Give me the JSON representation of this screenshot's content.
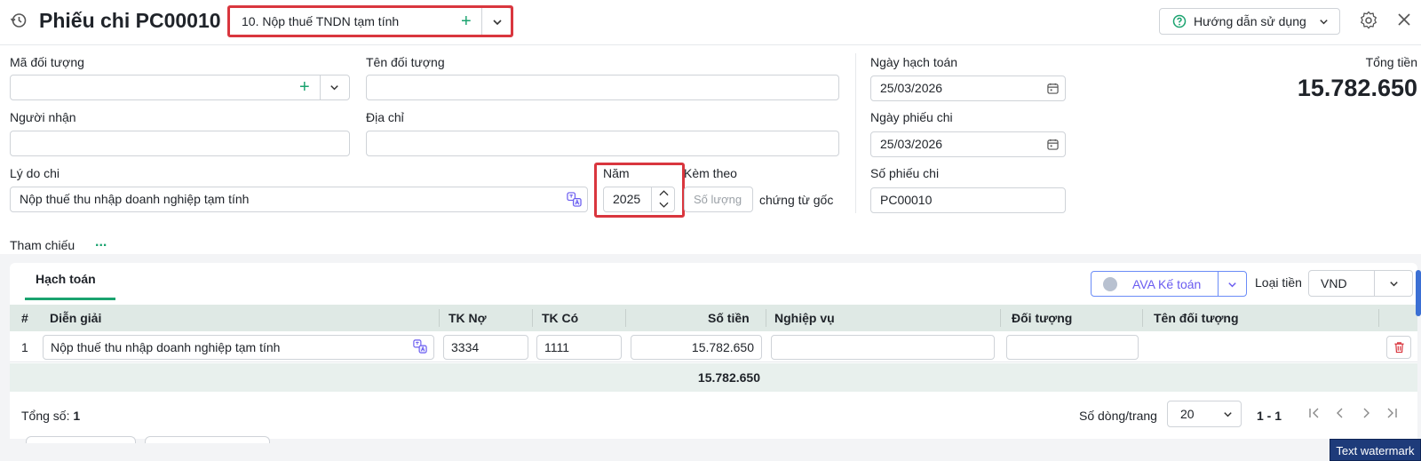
{
  "header": {
    "title": "Phiếu chi PC00010",
    "voucher_type": "10. Nộp thuế TNDN tạm tính",
    "help_label": "Hướng dẫn sử dụng"
  },
  "form": {
    "ma_doi_tuong": {
      "label": "Mã đối tượng",
      "value": ""
    },
    "ten_doi_tuong": {
      "label": "Tên đối tượng",
      "value": ""
    },
    "nguoi_nhan": {
      "label": "Người nhận",
      "value": ""
    },
    "dia_chi": {
      "label": "Địa chỉ",
      "value": ""
    },
    "ly_do_chi": {
      "label": "Lý do chi",
      "value": "Nộp thuế thu nhập doanh nghiệp tạm tính"
    },
    "nam": {
      "label": "Năm",
      "value": "2025"
    },
    "kem_theo": {
      "label": "Kèm theo",
      "placeholder": "Số lượng",
      "suffix": "chứng từ gốc"
    },
    "ngay_hach_toan": {
      "label": "Ngày hạch toán",
      "value": "25/03/2026"
    },
    "ngay_phieu_chi": {
      "label": "Ngày phiếu chi",
      "value": "25/03/2026"
    },
    "so_phieu_chi": {
      "label": "Số phiếu chi",
      "value": "PC00010"
    },
    "tong_tien": {
      "label": "Tổng tiền",
      "value": "15.782.650"
    }
  },
  "reference": {
    "label": "Tham chiếu",
    "more": "..."
  },
  "panel": {
    "tab": "Hạch toán",
    "ava_label": "AVA Kế toán",
    "currency_label": "Loại tiền",
    "currency_value": "VND"
  },
  "grid": {
    "columns": [
      "#",
      "Diễn giải",
      "TK Nợ",
      "TK Có",
      "Số tiền",
      "Nghiệp vụ",
      "Đối tượng",
      "Tên đối tượng"
    ],
    "rows": [
      {
        "num": "1",
        "dien_giai": "Nộp thuế thu nhập doanh nghiệp tạm tính",
        "tk_no": "3334",
        "tk_co": "1111",
        "so_tien": "15.782.650",
        "nghiep_vu": "",
        "doi_tuong": "",
        "ten_doi_tuong": ""
      }
    ],
    "sum": "15.782.650"
  },
  "footer": {
    "count_label": "Tổng số:",
    "count_value": "1",
    "rows_per_page_label": "Số dòng/trang",
    "rows_per_page": "20",
    "page_range": "1 - 1"
  },
  "watermark": "Text watermark",
  "colors": {
    "accent": "#1aa36f",
    "highlight": "#d9363e",
    "ava": "#6a5cf0"
  }
}
